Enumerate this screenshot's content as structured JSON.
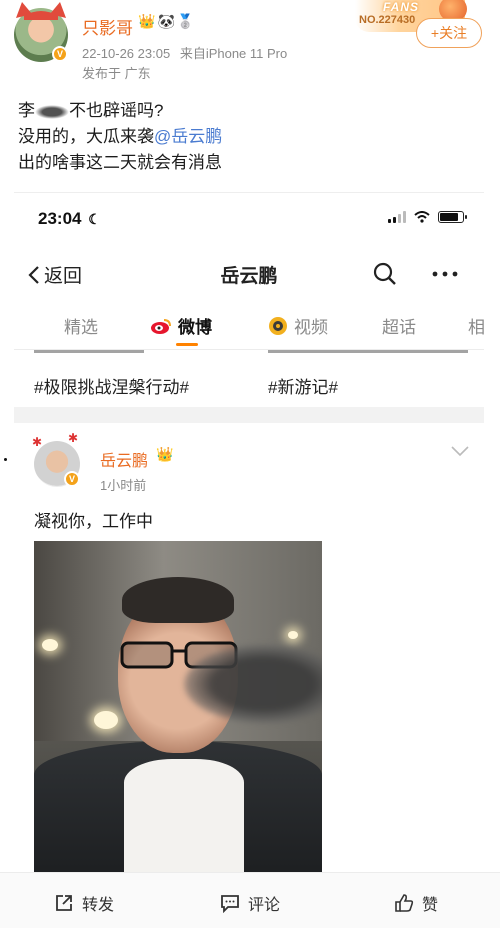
{
  "outer_post": {
    "username": "只影哥",
    "badges": [
      "👑",
      "🐼",
      "🥈"
    ],
    "timestamp": "22-10-26 23:05",
    "source": "来自iPhone 11 Pro",
    "location": "发布于 广东",
    "fans_word": "FANS",
    "fans_number": "NO.227430",
    "follow_label": "+关注",
    "text_line1_before": "李",
    "text_line1_after": "不也辟谣吗?",
    "text_line2_prefix": "没用的，大瓜来袭",
    "text_line2_mention": "@岳云鹏",
    "text_line3": "出的啥事这二天就会有消息"
  },
  "embedded": {
    "status_time": "23:04",
    "back_label": "返回",
    "nav_title": "岳云鹏",
    "tabs": [
      {
        "label": "精选",
        "active": false
      },
      {
        "label": "微博",
        "active": true
      },
      {
        "label": "视频",
        "active": false
      },
      {
        "label": "超话",
        "active": false
      },
      {
        "label": "相",
        "active": false
      }
    ],
    "topics": [
      "#极限挑战涅槃行动#",
      "#新游记#"
    ],
    "inner_post": {
      "username": "岳云鹏",
      "time": "1小时前",
      "text": "凝视你，工作中"
    }
  },
  "actions": {
    "repost": "转发",
    "comment": "评论",
    "like": "赞"
  },
  "colors": {
    "accent_orange": "#e96b22",
    "mention_blue": "#4a7bd0",
    "tab_underline": "#ff8200"
  }
}
